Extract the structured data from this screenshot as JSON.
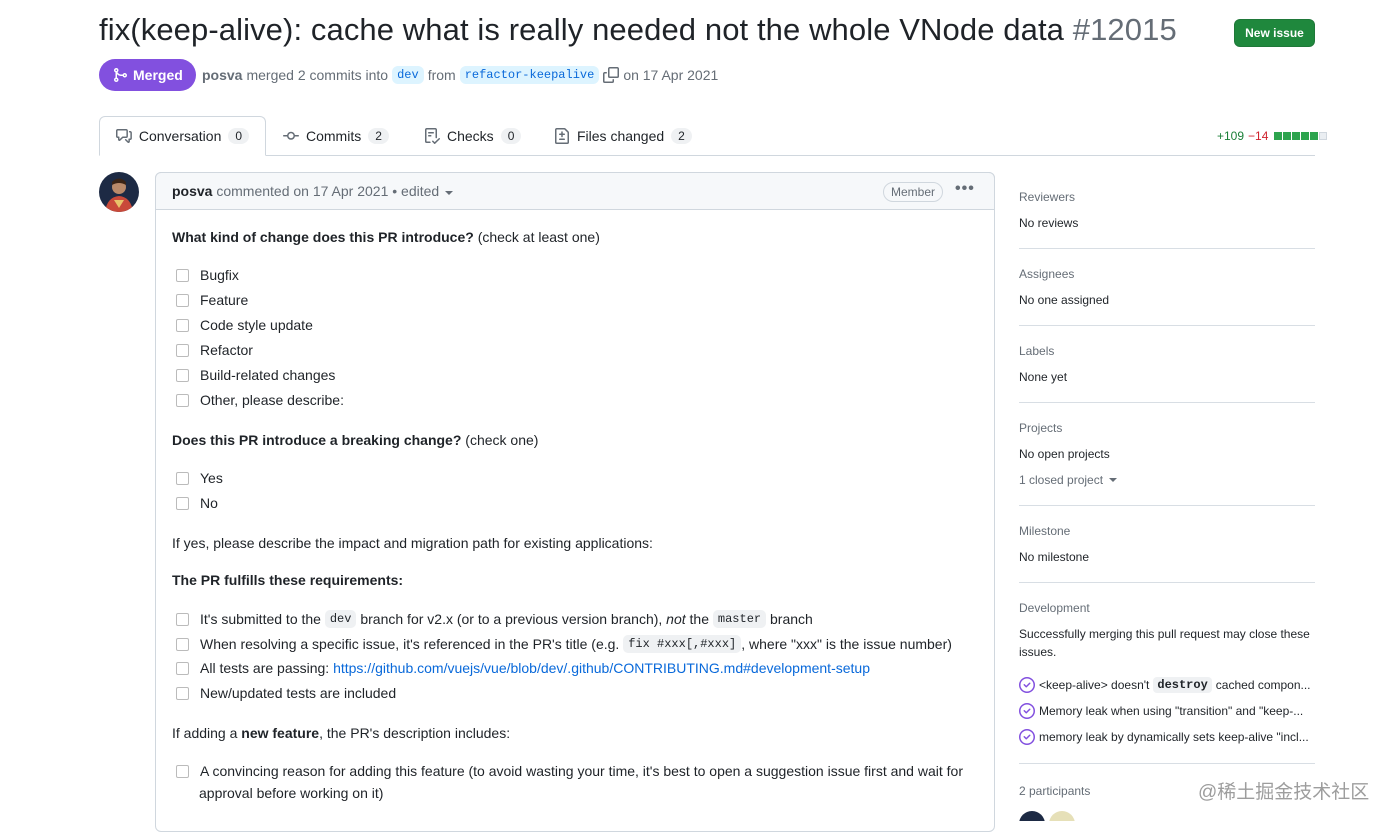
{
  "pr": {
    "title": "fix(keep-alive): cache what is really needed not the whole VNode data",
    "number": "#12015",
    "state": "Merged",
    "author": "posva",
    "merge_text": "merged 2 commits into",
    "base_branch": "dev",
    "from_text": "from",
    "head_branch": "refactor-keepalive",
    "date_text": "on 17 Apr 2021",
    "new_issue_label": "New issue"
  },
  "tabs": [
    {
      "label": "Conversation",
      "count": "0",
      "icon": "comment-discussion-icon"
    },
    {
      "label": "Commits",
      "count": "2",
      "icon": "git-commit-icon"
    },
    {
      "label": "Checks",
      "count": "0",
      "icon": "checklist-icon"
    },
    {
      "label": "Files changed",
      "count": "2",
      "icon": "file-diff-icon"
    }
  ],
  "diffstat": {
    "additions": "+109",
    "deletions": "−14",
    "blocks": [
      "green",
      "green",
      "green",
      "green",
      "green",
      "gray"
    ]
  },
  "comment": {
    "author": "posva",
    "header_text": "commented on 17 Apr 2021 • edited",
    "role_badge": "Member",
    "q1_bold": "What kind of change does this PR introduce?",
    "q1_rest": "(check at least one)",
    "change_types": [
      "Bugfix",
      "Feature",
      "Code style update",
      "Refactor",
      "Build-related changes",
      "Other, please describe:"
    ],
    "q2_bold": "Does this PR introduce a breaking change?",
    "q2_rest": "(check one)",
    "breaking": [
      "Yes",
      "No"
    ],
    "impact_text": "If yes, please describe the impact and migration path for existing applications:",
    "req_title": "The PR fulfills these requirements:",
    "req1": {
      "a": "It's submitted to the",
      "code1": "dev",
      "b": "branch for v2.x (or to a previous version branch),",
      "em": "not",
      "c": "the",
      "code2": "master",
      "d": "branch"
    },
    "req2": {
      "a": "When resolving a specific issue, it's referenced in the PR's title (e.g.",
      "code": "fix #xxx[,#xxx]",
      "b": ", where \"xxx\" is the issue number)"
    },
    "req3": {
      "a": "All tests are passing:",
      "link": "https://github.com/vuejs/vue/blob/dev/.github/CONTRIBUTING.md#development-setup"
    },
    "req4": "New/updated tests are included",
    "feature": {
      "a": "If adding a",
      "bold": "new feature",
      "b": ", the PR's description includes:"
    },
    "feature_item_line1": "A convincing reason for adding this feature (to avoid wasting your time, it's best to open a suggestion issue first and wait for",
    "feature_item_line2": "approval before working on it)"
  },
  "sidebar": {
    "reviewers": {
      "title": "Reviewers",
      "value": "No reviews"
    },
    "assignees": {
      "title": "Assignees",
      "value": "No one assigned"
    },
    "labels": {
      "title": "Labels",
      "value": "None yet"
    },
    "projects": {
      "title": "Projects",
      "value": "No open projects",
      "closed": "1 closed project"
    },
    "milestone": {
      "title": "Milestone",
      "value": "No milestone"
    },
    "development": {
      "title": "Development",
      "desc_line1": "Successfully merging this pull request may close these",
      "desc_line2": "issues.",
      "issues": [
        {
          "a": "<keep-alive> doesn't",
          "code": "destroy",
          "b": "cached compon..."
        },
        {
          "a": "Memory leak when using \"transition\" and \"keep-...",
          "code": "",
          "b": ""
        },
        {
          "a": "memory leak by dynamically sets keep-alive \"incl...",
          "code": "",
          "b": ""
        }
      ]
    },
    "participants": "2 participants"
  },
  "watermark": "@稀土掘金技术社区",
  "colors": {
    "merged": "#8250df",
    "new_issue": "#1f883d",
    "add": "#1a7f37",
    "del": "#cf222e",
    "link": "#0969da"
  }
}
